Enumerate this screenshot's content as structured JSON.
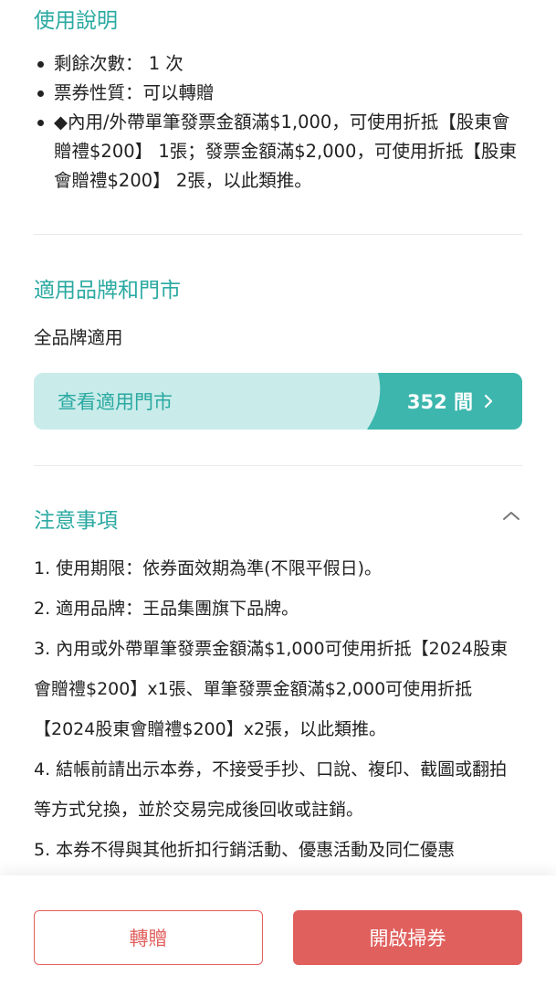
{
  "usage": {
    "title": "使用說明",
    "items": [
      "剩餘次數： 1 次",
      "票券性質：可以轉贈",
      "◆內用/外帶單筆發票金額滿$1,000，可使用折抵【股東會贈禮$200】 1張；發票金額滿$2,000，可使用折抵【股東會贈禮$200】 2張，以此類推。"
    ]
  },
  "brands": {
    "title": "適用品牌和門市",
    "scope": "全品牌適用",
    "store_button_label": "查看適用門市",
    "store_count": "352 間"
  },
  "notes": {
    "title": "注意事項",
    "items": [
      "1. 使用期限：依券面效期為準(不限平假日)。",
      "2. 適用品牌：王品集團旗下品牌。",
      "3. 內用或外帶單筆發票金額滿$1,000可使用折抵【2024股東會贈禮$200】x1張、單筆發票金額滿$2,000可使用折抵【2024股東會贈禮$200】x2張，以此類推。",
      "4. 結帳前請出示本券，不接受手抄、口說、複印、截圖或翻拍等方式兌換，並於交易完成後回收或註銷。",
      "5. 本券不得與其他折扣行銷活動、優惠活動及同仁優惠"
    ]
  },
  "footer": {
    "gift_label": "轉贈",
    "open_label": "開啟掃券"
  },
  "colors": {
    "accent": "#2aa9a1",
    "accent_light": "#c9ecea",
    "action": "#e0605d"
  }
}
